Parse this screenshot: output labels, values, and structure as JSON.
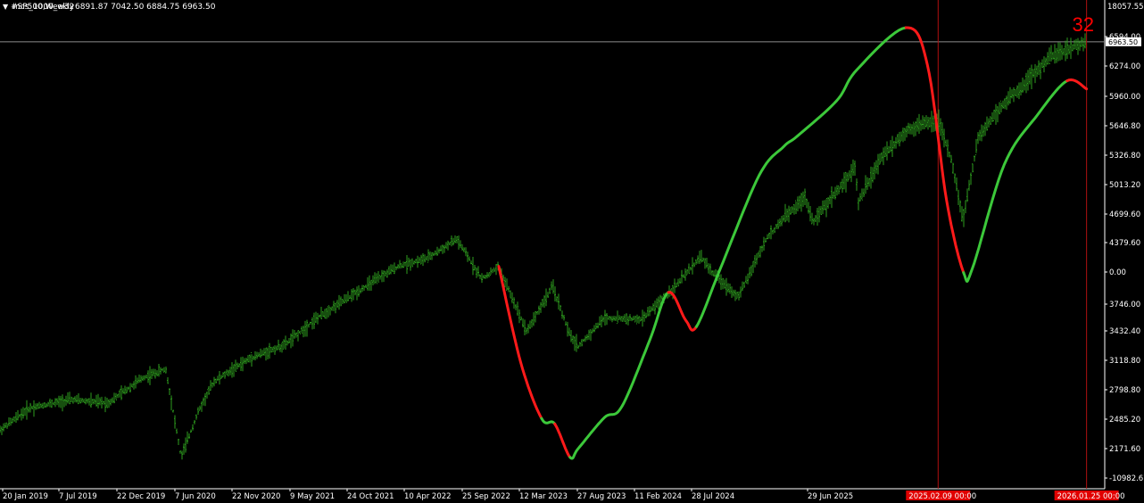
{
  "header": {
    "arrow": "▼",
    "symbol_text": "#SP500,Weekly",
    "overlay_text": "mcs_1000_w32",
    "ohlc": "6891.87 7042.50 6884.75 6963.50"
  },
  "counter": "32",
  "colors": {
    "background": "#000000",
    "bars": "#2e9e1e",
    "curve_up": "#3cc83a",
    "curve_down": "#ff1a1a",
    "price_line": "#8c8c8c",
    "vlines": "#b01010",
    "axis_text": "#ffffff",
    "date_tag_bg": "#e00000"
  },
  "chart_data": {
    "type": "line",
    "title": "#SP500,Weekly",
    "xlabel": "",
    "ylabel": "",
    "ylim": [
      2000,
      7160
    ],
    "x_ticks": [
      "20 Jan 2019",
      "7 Jul 2019",
      "22 Dec 2019",
      "7 Jun 2020",
      "22 Nov 2020",
      "9 May 2021",
      "24 Oct 2021",
      "10 Apr 2022",
      "25 Sep 2022",
      "12 Mar 2023",
      "27 Aug 2023",
      "11 Feb 2024",
      "28 Jul 2024",
      "29 Jun 2025"
    ],
    "y_ticks": [
      "18057.558",
      "6594.00",
      "6274.00",
      "5960.00",
      "5646.80",
      "5326.80",
      "5013.20",
      "4699.60",
      "4379.60",
      "0.00",
      "3746.00",
      "3432.40",
      "3118.80",
      "2798.80",
      "2485.20",
      "2171.60",
      "-10982.677"
    ],
    "current_price": "6963.50",
    "marker_dates": [
      "2025.02.09 00:00",
      "2026.01.25 00:00"
    ],
    "series": [
      {
        "name": "#SP500",
        "values": [
          [
            "2019-01-20",
            2650
          ],
          [
            "2019-04-01",
            2900
          ],
          [
            "2019-07-07",
            2990
          ],
          [
            "2019-10-01",
            2950
          ],
          [
            "2019-12-22",
            3230
          ],
          [
            "2020-02-15",
            3330
          ],
          [
            "2020-03-22",
            2350
          ],
          [
            "2020-05-01",
            2850
          ],
          [
            "2020-06-07",
            3190
          ],
          [
            "2020-09-01",
            3450
          ],
          [
            "2020-11-22",
            3600
          ],
          [
            "2021-02-01",
            3880
          ],
          [
            "2021-05-09",
            4180
          ],
          [
            "2021-08-15",
            4470
          ],
          [
            "2021-10-24",
            4560
          ],
          [
            "2022-01-01",
            4770
          ],
          [
            "2022-03-01",
            4330
          ],
          [
            "2022-04-10",
            4460
          ],
          [
            "2022-06-15",
            3750
          ],
          [
            "2022-08-15",
            4250
          ],
          [
            "2022-09-25",
            3700
          ],
          [
            "2022-10-15",
            3580
          ],
          [
            "2022-12-15",
            3900
          ],
          [
            "2023-03-12",
            3880
          ],
          [
            "2023-06-01",
            4250
          ],
          [
            "2023-07-30",
            4580
          ],
          [
            "2023-08-27",
            4400
          ],
          [
            "2023-10-27",
            4130
          ],
          [
            "2023-12-31",
            4770
          ],
          [
            "2024-02-11",
            5000
          ],
          [
            "2024-04-01",
            5250
          ],
          [
            "2024-04-20",
            4960
          ],
          [
            "2024-07-28",
            5570
          ],
          [
            "2024-08-05",
            5190
          ],
          [
            "2024-10-01",
            5700
          ],
          [
            "2024-12-01",
            6000
          ],
          [
            "2025-02-09",
            6100
          ],
          [
            "2025-03-15",
            5600
          ],
          [
            "2025-04-08",
            4980
          ],
          [
            "2025-05-15",
            5900
          ],
          [
            "2025-06-29",
            6200
          ],
          [
            "2025-09-01",
            6500
          ],
          [
            "2025-11-01",
            6800
          ],
          [
            "2026-01-25",
            6963.5
          ]
        ]
      },
      {
        "name": "mcs_1000_w32",
        "values": [
          [
            "2022-04-10",
            4470
          ],
          [
            "2022-06-01",
            3400
          ],
          [
            "2022-07-20",
            2780
          ],
          [
            "2022-08-20",
            2720
          ],
          [
            "2022-09-25",
            2350
          ],
          [
            "2022-10-15",
            2450
          ],
          [
            "2022-12-15",
            2790
          ],
          [
            "2023-01-25",
            2910
          ],
          [
            "2023-04-01",
            3650
          ],
          [
            "2023-05-15",
            4180
          ],
          [
            "2023-06-25",
            3870
          ],
          [
            "2023-07-20",
            3800
          ],
          [
            "2023-09-15",
            4450
          ],
          [
            "2023-12-15",
            5480
          ],
          [
            "2024-02-11",
            5800
          ],
          [
            "2024-03-15",
            5920
          ],
          [
            "2024-06-15",
            6310
          ],
          [
            "2024-08-01",
            6650
          ],
          [
            "2024-11-25",
            7120
          ],
          [
            "2025-01-15",
            6700
          ],
          [
            "2025-03-01",
            5200
          ],
          [
            "2025-04-10",
            4400
          ],
          [
            "2025-05-01",
            4450
          ],
          [
            "2025-07-15",
            5600
          ],
          [
            "2025-10-01",
            6150
          ],
          [
            "2025-12-10",
            6530
          ],
          [
            "2026-01-25",
            6440
          ]
        ],
        "segments": [
          {
            "from": "2022-04-10",
            "to": "2022-07-20",
            "direction": "down"
          },
          {
            "from": "2022-07-20",
            "to": "2022-08-20",
            "direction": "up"
          },
          {
            "from": "2022-08-20",
            "to": "2022-09-25",
            "direction": "down"
          },
          {
            "from": "2022-09-25",
            "to": "2023-05-15",
            "direction": "up"
          },
          {
            "from": "2023-05-15",
            "to": "2023-07-20",
            "direction": "down"
          },
          {
            "from": "2023-07-20",
            "to": "2024-11-25",
            "direction": "up"
          },
          {
            "from": "2024-11-25",
            "to": "2025-04-10",
            "direction": "down"
          },
          {
            "from": "2025-04-10",
            "to": "2025-12-10",
            "direction": "up"
          },
          {
            "from": "2025-12-10",
            "to": "2026-01-25",
            "direction": "down"
          }
        ]
      }
    ]
  }
}
